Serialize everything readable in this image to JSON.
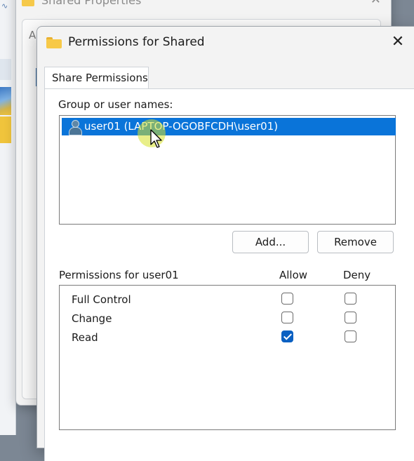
{
  "background_dialog": {
    "title": "Shared Properties",
    "tab_letter": "A"
  },
  "dialog": {
    "title": "Permissions for Shared",
    "close_glyph": "✕",
    "tab_label": "Share Permissions",
    "group_label": "Group or user names:",
    "users": [
      {
        "label": "user01 (LAPTOP-OGOBFCDH\\user01)",
        "selected": true,
        "icon": "user-icon"
      }
    ],
    "add_button": "Add...",
    "remove_button": "Remove",
    "permissions_label": "Permissions for user01",
    "allow_header": "Allow",
    "deny_header": "Deny",
    "permissions": [
      {
        "name": "Full Control",
        "allow": false,
        "deny": false
      },
      {
        "name": "Change",
        "allow": false,
        "deny": false
      },
      {
        "name": "Read",
        "allow": true,
        "deny": false
      }
    ]
  },
  "colors": {
    "selection": "#0a74d9",
    "checkbox_checked": "#0a60c2",
    "folder": "#f7c948"
  }
}
